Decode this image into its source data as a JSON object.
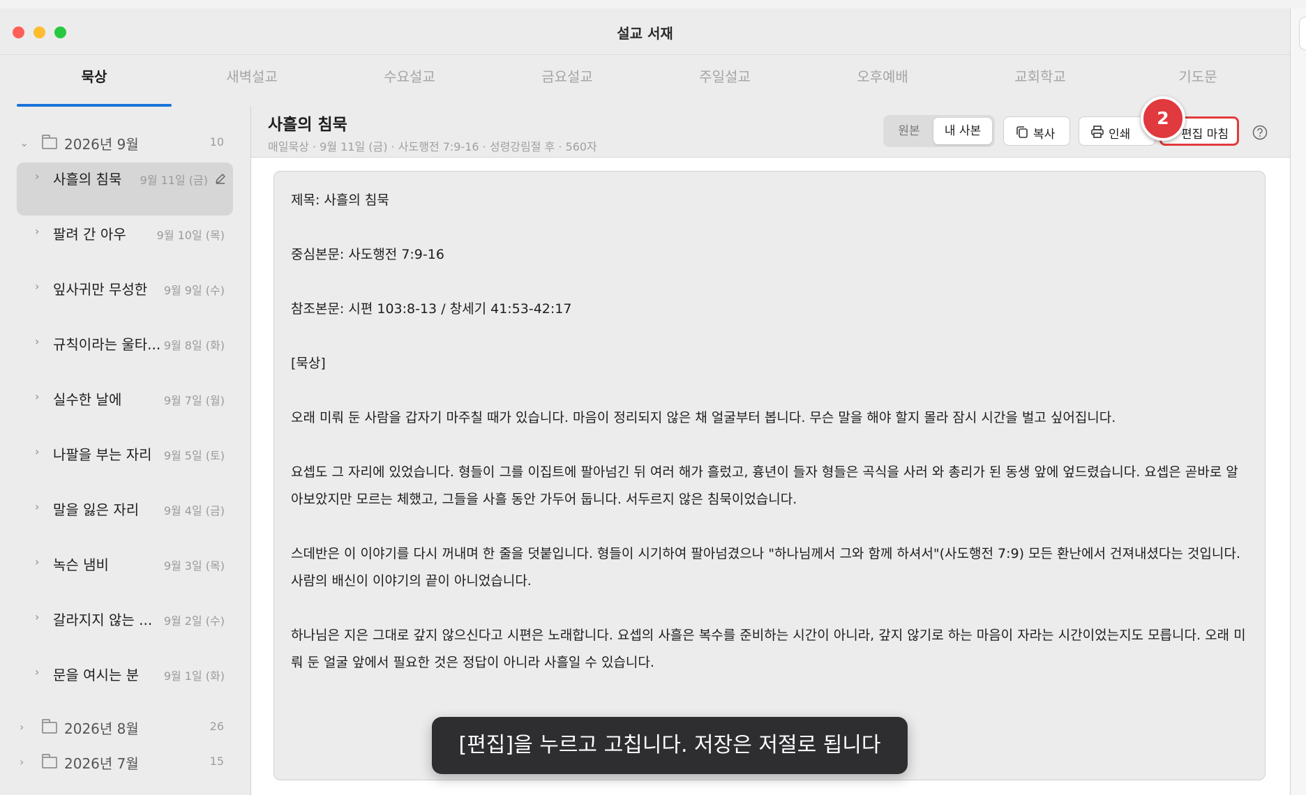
{
  "window": {
    "title": "설교 서재"
  },
  "tabs": [
    {
      "label": "묵상",
      "active": true
    },
    {
      "label": "새벽설교"
    },
    {
      "label": "수요설교"
    },
    {
      "label": "금요설교"
    },
    {
      "label": "주일설교"
    },
    {
      "label": "오후예배"
    },
    {
      "label": "교회학교"
    },
    {
      "label": "기도문"
    }
  ],
  "sidebar": {
    "folders": [
      {
        "name": "2026년 9월",
        "count": "10",
        "expanded": true
      },
      {
        "name": "2026년 8월",
        "count": "26",
        "expanded": false
      },
      {
        "name": "2026년 7월",
        "count": "15",
        "expanded": false
      }
    ],
    "entries": [
      {
        "title": "사흘의 침묵",
        "date": "9월 11일 (금)",
        "selected": true
      },
      {
        "title": "팔려 간 아우",
        "date": "9월 10일 (목)"
      },
      {
        "title": "잎사귀만 무성한",
        "date": "9월 9일 (수)"
      },
      {
        "title": "규칙이라는 울타...",
        "date": "9월 8일 (화)"
      },
      {
        "title": "실수한 날에",
        "date": "9월 7일 (월)"
      },
      {
        "title": "나팔을 부는 자리",
        "date": "9월 5일 (토)"
      },
      {
        "title": "말을 잃은 자리",
        "date": "9월 4일 (금)"
      },
      {
        "title": "녹슨 냄비",
        "date": "9월 3일 (목)"
      },
      {
        "title": "갈라지지 않는 ...",
        "date": "9월 2일 (수)"
      },
      {
        "title": "문을 여시는 분",
        "date": "9월 1일 (화)"
      }
    ]
  },
  "document": {
    "title": "사흘의 침묵",
    "meta": "매일묵상 · 9월 11일 (금) · 사도행전 7:9-16 · 성령강림절 후 · 560자",
    "view_toggle": {
      "original": "원본",
      "my_copy": "내 사본",
      "selected": "my_copy"
    },
    "actions": {
      "copy": "복사",
      "print": "인쇄",
      "finish_edit": "편집 마침"
    },
    "body": [
      "제목: 사흘의 침묵",
      "중심본문: 사도행전 7:9-16",
      "참조본문: 시편 103:8-13 / 창세기 41:53-42:17",
      "[묵상]",
      "오래 미뤄 둔 사람을 갑자기 마주칠 때가 있습니다. 마음이 정리되지 않은 채 얼굴부터 봅니다. 무슨 말을 해야 할지 몰라 잠시 시간을 벌고 싶어집니다.",
      "요셉도 그 자리에 있었습니다. 형들이 그를 이집트에 팔아넘긴 뒤 여러 해가 흘렀고, 흉년이 들자 형들은 곡식을 사러 와 총리가 된 동생 앞에 엎드렸습니다. 요셉은 곧바로 알아보았지만 모르는 체했고, 그들을 사흘 동안 가두어 둡니다. 서두르지 않은 침묵이었습니다.",
      "스데반은 이 이야기를 다시 꺼내며 한 줄을 덧붙입니다. 형들이 시기하여 팔아넘겼으나 \"하나님께서 그와 함께 하셔서\"(사도행전 7:9) 모든 환난에서 건져내셨다는 것입니다. 사람의 배신이 이야기의 끝이 아니었습니다.",
      "하나님은 지은 그대로 갚지 않으신다고 시편은 노래합니다. 요셉의 사흘은 복수를 준비하는 시간이 아니라, 갚지 않기로 하는 마음이 자라는 시간이었는지도 모릅니다. 오래 미뤄 둔 얼굴 앞에서 필요한 것은 정답이 아니라 사흘일 수 있습니다."
    ]
  },
  "tutorial": {
    "step_number": "2",
    "toast": "[편집]을 누르고 고칩니다. 저장은 저절로 됩니다"
  },
  "colors": {
    "accent": "#1a73d9",
    "highlight": "#e23b3b",
    "toast_bg": "#2e2e31"
  }
}
